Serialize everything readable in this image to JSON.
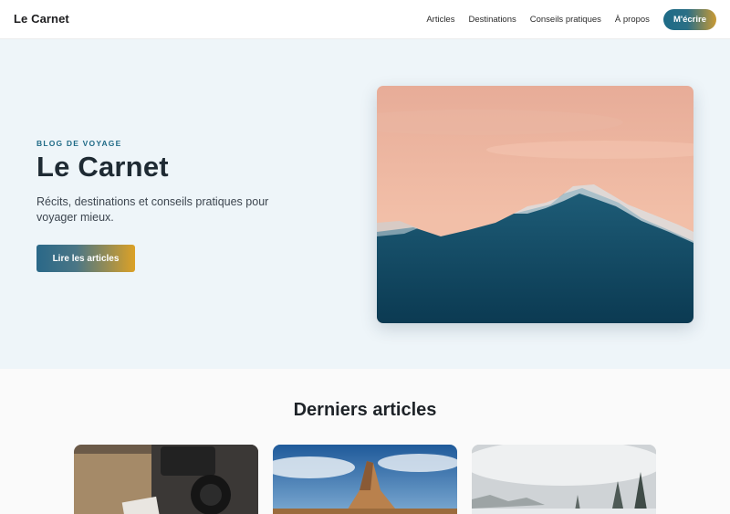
{
  "header": {
    "brand": "Le Carnet",
    "nav": [
      {
        "label": "Articles"
      },
      {
        "label": "Destinations"
      },
      {
        "label": "Conseils pratiques"
      },
      {
        "label": "À propos"
      }
    ],
    "cta_label": "M'écrire",
    "cta_colors": [
      "#1d6b87",
      "#c99a34"
    ]
  },
  "hero": {
    "kicker": "BLOG DE VOYAGE",
    "title": "Le Carnet",
    "subtitle": "Récits, destinations et conseils pratiques pour voyager mieux.",
    "button_label": "Lire les articles",
    "image_icon": "mountain-sunset-image"
  },
  "latest": {
    "title": "Derniers articles",
    "cards": [
      {
        "image_icon": "camera-map-image"
      },
      {
        "image_icon": "desert-rock-image"
      },
      {
        "image_icon": "snowy-forest-image"
      }
    ]
  },
  "colors": {
    "accent_blue": "#1f6a86",
    "accent_gold": "#dca126",
    "hero_bg": "#eef5f9"
  }
}
